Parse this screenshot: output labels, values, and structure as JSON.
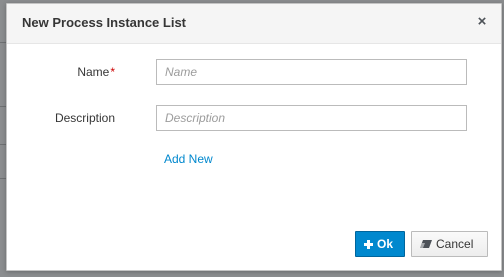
{
  "dialog": {
    "title": "New Process Instance List",
    "close_symbol": "×",
    "fields": [
      {
        "label": "Name",
        "required_mark": "*",
        "placeholder": "Name",
        "value": ""
      },
      {
        "label": "Description",
        "placeholder": "Description",
        "value": ""
      }
    ],
    "add_new_label": "Add New",
    "ok_label": "Ok",
    "ok_icon": "plus-icon",
    "cancel_label": "Cancel",
    "cancel_icon": "eraser-icon"
  },
  "colors": {
    "primary": "#0088ce",
    "link": "#0088ce",
    "required": "#cc0000",
    "header_bg": "#f5f5f5"
  }
}
